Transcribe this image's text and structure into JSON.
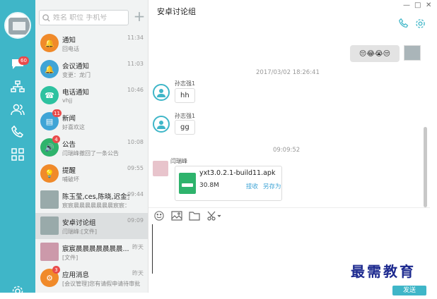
{
  "search": {
    "placeholder": "姓名 职位 手机号"
  },
  "rail": {
    "message_badge": "60"
  },
  "conversations": [
    {
      "title": "通知",
      "sub": "回电话",
      "time": "11:34",
      "icon": "bell-icon",
      "color": "#f08a2a"
    },
    {
      "title": "会议通知",
      "sub": "变更：龙门",
      "time": "11:03",
      "icon": "bell-outline-icon",
      "color": "#3fa4d6"
    },
    {
      "title": "电话通知",
      "sub": "vhjj",
      "time": "10:46",
      "icon": "phone-screen-icon",
      "color": "#2ec2a0"
    },
    {
      "title": "新闻",
      "sub": "好喜欢这",
      "time": "",
      "icon": "news-icon",
      "color": "#3fa4d6",
      "badge": "11"
    },
    {
      "title": "公告",
      "sub": "闫瑞峰撤回了一条公告",
      "time": "10:08",
      "icon": "speaker-icon",
      "color": "#2eb36c",
      "badge": "4"
    },
    {
      "title": "提醒",
      "sub": "哺破坏",
      "time": "09:55",
      "icon": "lightbulb-icon",
      "color": "#f08a2a"
    },
    {
      "title": "陈玉莹,ces,陈晓,迟金全,...",
      "sub": "宸宸晨晨晨晨晨晨晨宸宸：",
      "time": "09:44",
      "icon": "group-photo-icon",
      "color": "#9aa"
    },
    {
      "title": "安卓讨论组",
      "sub": "闫瑞峰:[文件]",
      "time": "09:09",
      "icon": "group-photo-icon",
      "color": "#9aa",
      "active": true
    },
    {
      "title": "宸宸晨晨晨晨晨晨晨...",
      "sub": "[文件]",
      "time": "昨天",
      "icon": "photo-icon",
      "color": "#c9a"
    },
    {
      "title": "应用消息",
      "sub": "[会议管理]您有请假申请待审批",
      "time": "昨天",
      "icon": "app-icon",
      "color": "#f08a2a",
      "badge": "3"
    }
  ],
  "chat": {
    "title": "安卓讨论组",
    "my_emojis": "😔😂😭😒",
    "ts1": "2017/03/02 18:26:41",
    "sender1": "孙志强1",
    "msg1": "hh",
    "sender2": "孙志强1",
    "msg2": "gg",
    "ts2": "09:09:52",
    "sender3": "闫瑞峰",
    "file_name": "yxt3.0.2.1-build11.apk",
    "file_size": "30.8M",
    "receive": "接收",
    "save_as": "另存为",
    "send_label": "发送"
  },
  "watermark": "最需教育",
  "colors": {
    "accent": "#3fb6c8",
    "badge": "#e94b4b",
    "link": "#3fa4d6"
  }
}
